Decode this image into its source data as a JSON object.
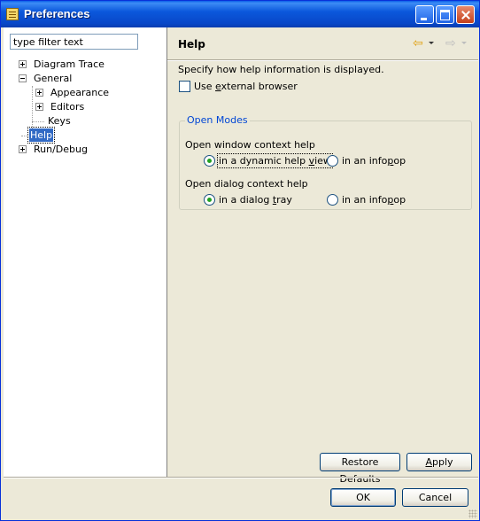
{
  "window": {
    "title": "Preferences"
  },
  "filter": {
    "placeholder": "type filter text"
  },
  "tree": {
    "diagram_trace": "Diagram Trace",
    "general": "General",
    "appearance": "Appearance",
    "editors": "Editors",
    "keys": "Keys",
    "help": "Help",
    "run_debug": "Run/Debug"
  },
  "page": {
    "title": "Help",
    "description": "Specify how help information is displayed.",
    "use_external_browser": {
      "pre": "Use ",
      "mnemonic": "e",
      "post": "xternal browser",
      "checked": false
    },
    "group": {
      "title": "Open Modes",
      "window_label": "Open window context help",
      "window_opt1": {
        "pre": "in a dynamic help ",
        "mnemonic": "v",
        "post": "iew",
        "selected": true
      },
      "window_opt2": {
        "pre": "in an info",
        "mnemonic": "p",
        "post": "op",
        "selected": false
      },
      "dialog_label": "Open dialog context help",
      "dialog_opt1": {
        "pre": "in a dialog ",
        "mnemonic": "t",
        "post": "ray",
        "selected": true
      },
      "dialog_opt2": {
        "pre": "in an info",
        "mnemonic": "p",
        "post": "op",
        "selected": false
      }
    },
    "restore_defaults": "Restore Defaults",
    "apply": {
      "mnemonic": "A",
      "post": "pply"
    }
  },
  "footer": {
    "ok": "OK",
    "cancel": "Cancel"
  },
  "colors": {
    "selection": "#316ac5",
    "radio_dot": "#21a121",
    "group_title": "#0046d5",
    "titlebar": "#0a5fe8"
  },
  "icons": {
    "back": "back-arrow-icon",
    "forward": "forward-arrow-icon"
  }
}
